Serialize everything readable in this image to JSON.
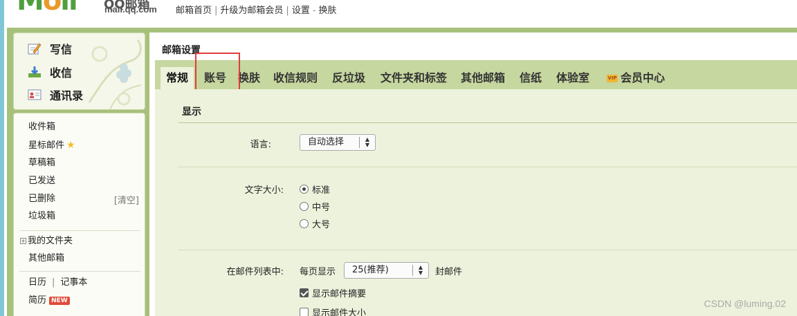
{
  "logo": {
    "brand_cn": "QQ邮箱",
    "domain": "mail.qq.com"
  },
  "top_links": [
    "邮箱首页",
    "升级为邮箱会员",
    "设置",
    "换肤"
  ],
  "sidebar": {
    "compose": [
      {
        "label": "写信",
        "icon": "pencil-paper-icon"
      },
      {
        "label": "收信",
        "icon": "download-tray-icon"
      },
      {
        "label": "通讯录",
        "icon": "contact-card-icon"
      }
    ],
    "folders": {
      "inbox": "收件箱",
      "starred": "星标邮件",
      "drafts": "草稿箱",
      "sent": "已发送",
      "deleted": "已删除",
      "clear": "[清空]",
      "trash": "垃圾箱",
      "my_folders": "我的文件夹",
      "other_mailbox": "其他邮箱",
      "calendar": "日历",
      "notes": "记事本",
      "resume": "简历",
      "new_badge": "NEW"
    }
  },
  "main": {
    "title": "邮箱设置",
    "tabs": [
      "常规",
      "账号",
      "换肤",
      "收信规则",
      "反垃圾",
      "文件夹和标签",
      "其他邮箱",
      "信纸",
      "体验室",
      "会员中心"
    ],
    "vip_icon_text": "VIP",
    "section_title": "显示",
    "language": {
      "label": "语言:",
      "value": "自动选择"
    },
    "font_size": {
      "label": "文字大小:",
      "options": [
        "标准",
        "中号",
        "大号"
      ],
      "selected": "标准"
    },
    "mail_list": {
      "label": "在邮件列表中:",
      "per_page_label": "每页显示",
      "per_page_value": "25(推荐)",
      "unit": "封邮件",
      "show_summary": "显示邮件摘要",
      "show_summary_checked": true,
      "show_size": "显示邮件大小",
      "show_size_checked": false
    }
  },
  "watermark": "CSDN @luming.02",
  "colors": {
    "accent_green": "#a7c17c",
    "tab_bar": "#c6d79f",
    "panel_bg": "#edf2dc",
    "highlight_red": "#e03c3c"
  }
}
